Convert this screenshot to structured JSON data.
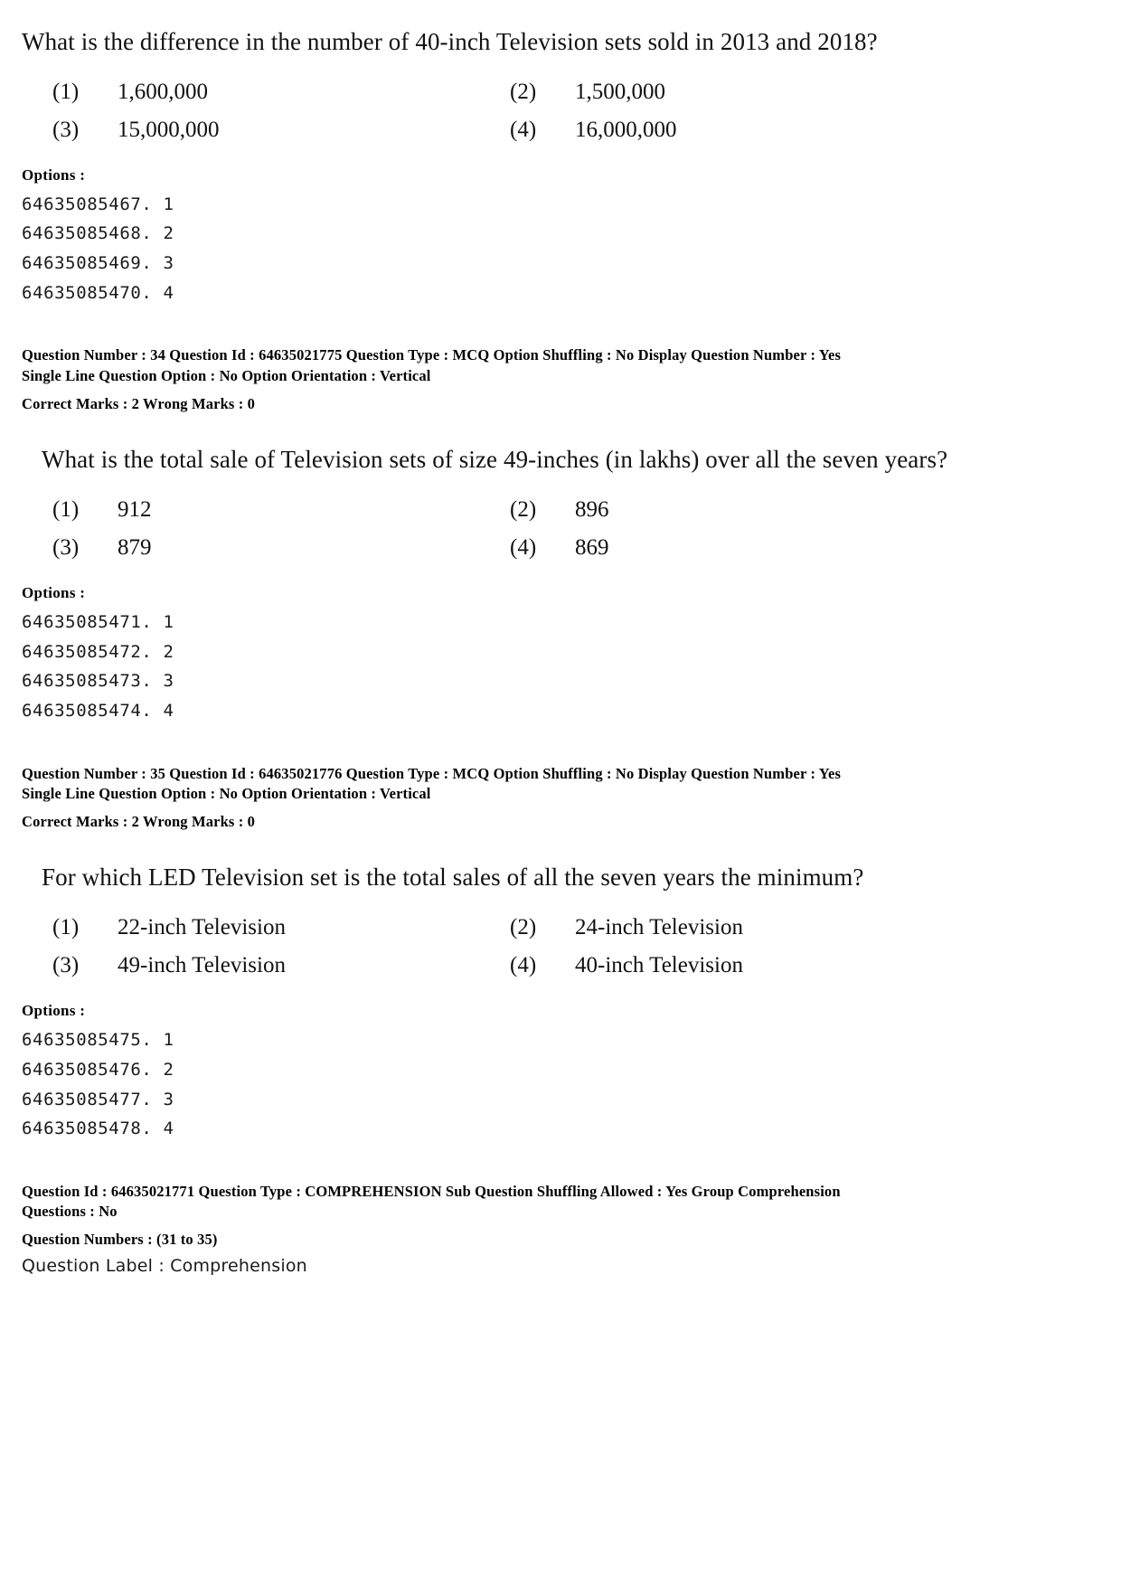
{
  "document": {
    "blocks": [
      {
        "kind": "question_body",
        "stem": "What is the difference in the number of 40-inch Television sets sold in 2013 and 2018?",
        "options": [
          {
            "num": "(1)",
            "text": "1,600,000"
          },
          {
            "num": "(2)",
            "text": "1,500,000"
          },
          {
            "num": "(3)",
            "text": "15,000,000"
          },
          {
            "num": "(4)",
            "text": "16,000,000"
          }
        ],
        "options_label": "Options :",
        "option_ids": [
          "64635085467. 1",
          "64635085468. 2",
          "64635085469. 3",
          "64635085470. 4"
        ]
      }
    ],
    "question_34": {
      "meta_line_1": "Question Number : 34  Question Id : 64635021775  Question Type : MCQ  Option Shuffling : No  Display Question Number : Yes",
      "meta_line_2": "Single Line Question Option : No  Option Orientation : Vertical",
      "meta_line_3": "Correct Marks : 2  Wrong Marks : 0",
      "stem": "What is the total sale of Television sets of size 49-inches (in lakhs) over all the seven years?",
      "options": [
        {
          "num": "(1)",
          "text": "912"
        },
        {
          "num": "(2)",
          "text": "896"
        },
        {
          "num": "(3)",
          "text": "879"
        },
        {
          "num": "(4)",
          "text": "869"
        }
      ],
      "options_label": "Options :",
      "option_ids": [
        "64635085471. 1",
        "64635085472. 2",
        "64635085473. 3",
        "64635085474. 4"
      ]
    },
    "question_35": {
      "meta_line_1": "Question Number : 35  Question Id : 64635021776  Question Type : MCQ  Option Shuffling : No  Display Question Number : Yes",
      "meta_line_2": "Single Line Question Option : No  Option Orientation : Vertical",
      "meta_line_3": "Correct Marks : 2  Wrong Marks : 0",
      "stem": "For which LED Television set is the total sales of all the seven years the minimum?",
      "options": [
        {
          "num": "(1)",
          "text": "22-inch Television"
        },
        {
          "num": "(2)",
          "text": "24-inch Television"
        },
        {
          "num": "(3)",
          "text": "49-inch Television"
        },
        {
          "num": "(4)",
          "text": "40-inch Television"
        }
      ],
      "options_label": "Options :",
      "option_ids": [
        "64635085475. 1",
        "64635085476. 2",
        "64635085477. 3",
        "64635085478. 4"
      ]
    },
    "comprehension": {
      "meta_line_1": "Question Id : 64635021771  Question Type : COMPREHENSION  Sub Question Shuffling Allowed : Yes  Group Comprehension",
      "meta_line_2": "Questions : No",
      "meta_line_3": "Question Numbers : (31 to 35)",
      "label_line": "Question Label : Comprehension"
    }
  }
}
